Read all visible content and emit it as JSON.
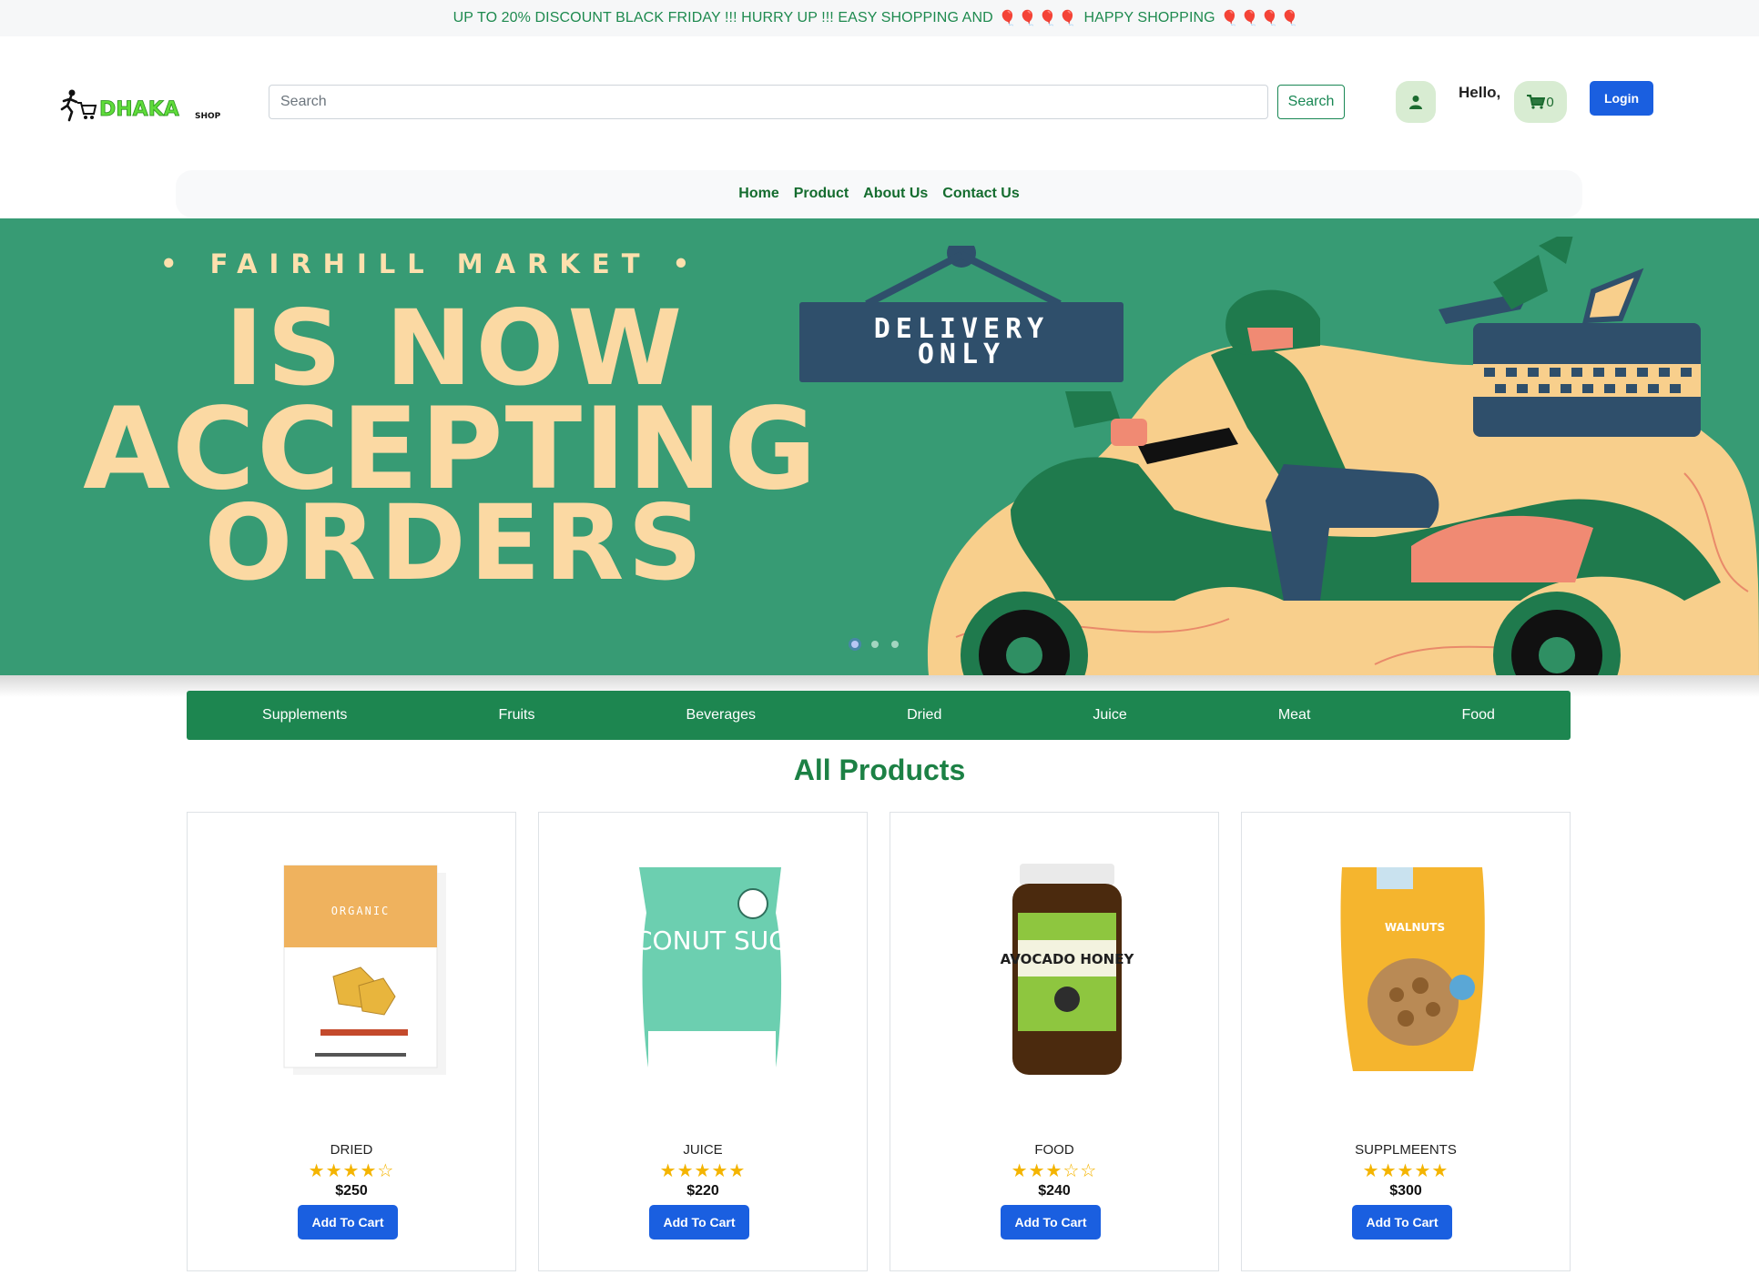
{
  "announcement": {
    "text_a": "UP TO 20% DISCOUNT BLACK FRIDAY !!! HURRY UP !!! EASY SHOPPING AND",
    "text_b": "HAPPY SHOPPING",
    "balloons": "🎈🎈🎈🎈"
  },
  "header": {
    "logo_main": "DHAKA",
    "logo_sub": "SHOP",
    "search_placeholder": "Search",
    "search_button": "Search",
    "greeting": "Hello,",
    "cart_count": "0",
    "login_button": "Login"
  },
  "nav": {
    "items": [
      "Home",
      "Product",
      "About Us",
      "Contact Us"
    ]
  },
  "banner": {
    "eyebrow": "• FAIRHILL MARKET •",
    "line1": "IS NOW",
    "line2": "ACCEPTING",
    "line3": "ORDERS",
    "sign_line1": "DELIVERY",
    "sign_line2": "ONLY",
    "slide_count": 3,
    "active_slide": 1
  },
  "categories": [
    "Supplements",
    "Fruits",
    "Beverages",
    "Dried",
    "Juice",
    "Meat",
    "Food"
  ],
  "section_title": "All Products",
  "products": [
    {
      "category": "DRIED",
      "rating": 4,
      "stars": "★★★★☆",
      "price": "$250",
      "button": "Add To Cart",
      "image_text": "ORGANIC"
    },
    {
      "category": "JUICE",
      "rating": 5,
      "stars": "★★★★★",
      "price": "$220",
      "button": "Add To Cart",
      "image_text": "COCONUT SUGAR"
    },
    {
      "category": "FOOD",
      "rating": 3,
      "stars": "★★★☆☆",
      "price": "$240",
      "button": "Add To Cart",
      "image_text": "AVOCADO HONEY"
    },
    {
      "category": "SUPPLMEENTS",
      "rating": 5,
      "stars": "★★★★★",
      "price": "$300",
      "button": "Add To Cart",
      "image_text": "WALNUTS"
    }
  ],
  "colors": {
    "brand_green": "#1d8650",
    "banner_green": "#379b74",
    "primary_blue": "#1a5fe0",
    "star_gold": "#f4b400"
  }
}
